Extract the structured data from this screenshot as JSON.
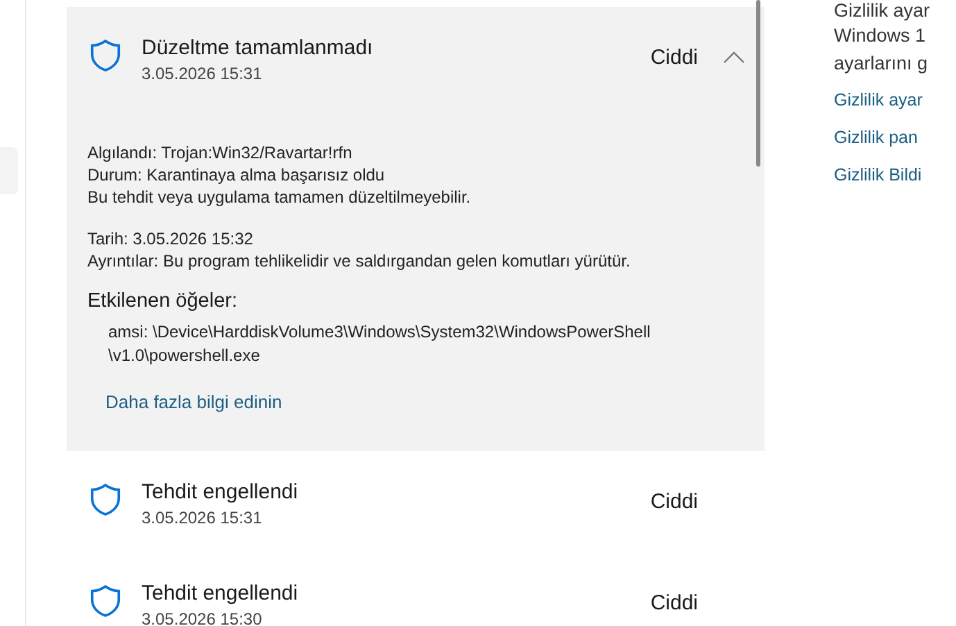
{
  "threats": [
    {
      "title": "Düzeltme tamamlanmadı",
      "date": "3.05.2026 15:31",
      "severity": "Ciddi",
      "expanded": true,
      "details": {
        "fields_top": [
          {
            "label": "Algılandı:",
            "value": "Trojan:Win32/Ravartar!rfn"
          },
          {
            "label": "Durum:",
            "value": "Karantinaya alma başarısız oldu"
          }
        ],
        "note": "Bu tehdit veya uygulama tamamen düzeltilmeyebilir.",
        "fields_bottom": [
          {
            "label": "Tarih:",
            "value": "3.05.2026 15:32"
          },
          {
            "label": "Ayrıntılar:",
            "value": "Bu program tehlikelidir ve saldırgandan gelen komutları yürütür."
          }
        ],
        "affected_heading": "Etkilenen öğeler:",
        "affected_items": [
          "amsi: \\Device\\HarddiskVolume3\\Windows\\System32\\WindowsPowerShell \\v1.0\\powershell.exe"
        ],
        "link": "Daha fazla bilgi edinin"
      }
    },
    {
      "title": "Tehdit engellendi",
      "date": "3.05.2026 15:31",
      "severity": "Ciddi",
      "expanded": false
    },
    {
      "title": "Tehdit engellendi",
      "date": "3.05.2026 15:30",
      "severity": "Ciddi",
      "expanded": false
    }
  ],
  "side_panel": {
    "heading": "Gizlilik ayar",
    "description_lines": [
      "Windows 1",
      "ayarlarını g"
    ],
    "links": [
      "Gizlilik ayar",
      "Gizlilik pan",
      "Gizlilik Bildi"
    ]
  }
}
